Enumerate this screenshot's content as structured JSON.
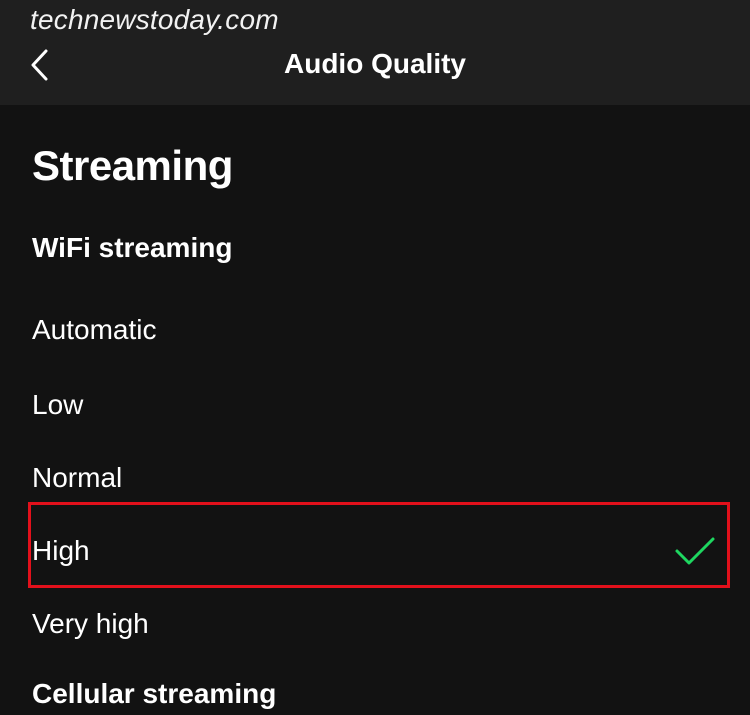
{
  "watermark": "technewstoday.com",
  "header": {
    "back_icon": "chevron-left-icon",
    "title": "Audio Quality"
  },
  "section": {
    "title": "Streaming"
  },
  "wifi_streaming": {
    "label": "WiFi streaming",
    "options": [
      {
        "label": "Automatic",
        "selected": false
      },
      {
        "label": "Low",
        "selected": false
      },
      {
        "label": "Normal",
        "selected": false
      },
      {
        "label": "High",
        "selected": true
      },
      {
        "label": "Very high",
        "selected": false
      }
    ]
  },
  "cellular_streaming": {
    "label": "Cellular streaming"
  },
  "colors": {
    "background": "#121212",
    "header_background": "#1f1f1f",
    "check": "#1ed760",
    "highlight": "#e2101b"
  }
}
